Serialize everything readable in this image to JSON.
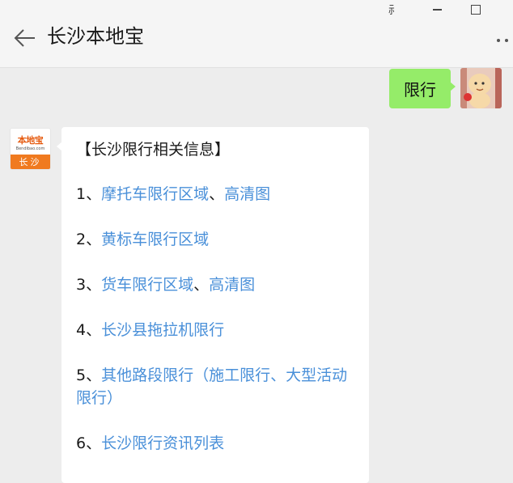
{
  "window": {
    "pin_glyph": "⺬",
    "title": "长沙本地宝"
  },
  "chat": {
    "user_message": "限行",
    "bot_logo": {
      "brand": "本地宝",
      "domain": "Bendibao.com",
      "city": "长沙"
    },
    "bot_message": {
      "heading": "【长沙限行相关信息】",
      "items": [
        {
          "num": "1、",
          "parts": [
            "摩托车限行区域",
            "、",
            "高清图"
          ]
        },
        {
          "num": "2、",
          "parts": [
            "黄标车限行区域"
          ]
        },
        {
          "num": "3、",
          "parts": [
            "货车限行区域",
            "、",
            "高清图"
          ]
        },
        {
          "num": "4、",
          "parts": [
            "长沙县拖拉机限行"
          ]
        },
        {
          "num": "5、",
          "parts": [
            "其他路段限行（施工限行、大型活动限行）"
          ]
        },
        {
          "num": "6、",
          "parts": [
            "长沙限行资讯列表"
          ]
        }
      ]
    }
  },
  "colors": {
    "link": "#4a90d9",
    "user_bubble": "#95ec69",
    "logo_orange": "#f07a1f"
  }
}
